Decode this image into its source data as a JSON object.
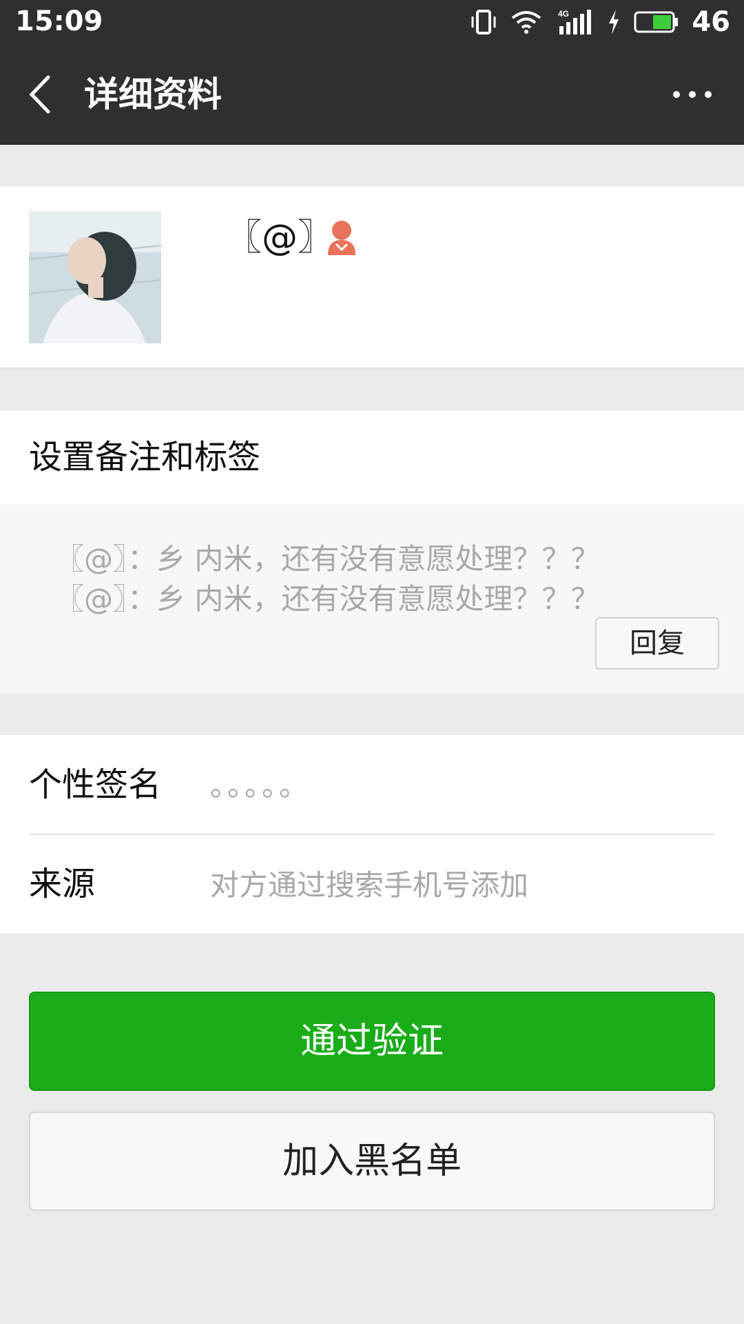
{
  "status_bar": {
    "time": "15:09",
    "network": "4G",
    "battery_percent": "46",
    "icons": [
      "vibrate-icon",
      "wifi-icon",
      "signal-icon",
      "charging-icon",
      "battery-icon"
    ]
  },
  "app_bar": {
    "title": "详细资料",
    "back_icon": "chevron-left-icon",
    "more_icon": "more-dots-icon"
  },
  "profile": {
    "nickname": "〖@〗",
    "gender_icon": "female-icon",
    "gender_color": "#e8735a"
  },
  "remark": {
    "label": "设置备注和标签"
  },
  "messages": {
    "lines": [
      "〖@〗：乡 内米，还有没有意愿处理？？？",
      "〖@〗：乡 内米，还有没有意愿处理？？？"
    ],
    "reply_label": "回复"
  },
  "info": {
    "signature_label": "个性签名",
    "signature_value": "。。。。。",
    "source_label": "来源",
    "source_value": "对方通过搜索手机号添加"
  },
  "actions": {
    "verify_label": "通过验证",
    "verify_color": "#1aad19",
    "blacklist_label": "加入黑名单"
  }
}
